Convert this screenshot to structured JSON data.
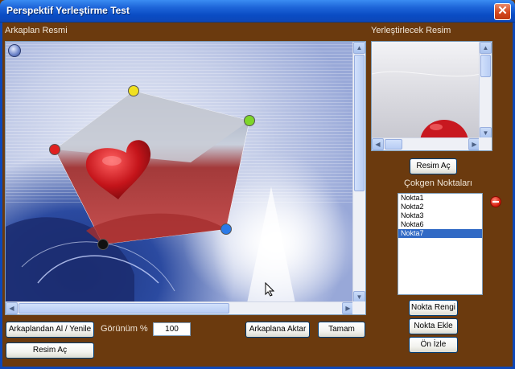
{
  "window": {
    "title": "Perspektif Yerleştirme Test",
    "close_glyph": "✕"
  },
  "labels": {
    "background_image": "Arkaplan Resmi",
    "image_to_place": "Yerleştirlecek Resim",
    "polygon_points": "Çokgen Noktaları",
    "view_percent": "Görünüm %"
  },
  "buttons": {
    "get_from_background": "Arkaplandan Al / Yenile",
    "open_image_left": "Resim Aç",
    "transfer_to_background": "Arkaplana Aktar",
    "ok": "Tamam",
    "open_image_right": "Resim Aç",
    "point_color": "Nokta Rengi",
    "add_point": "Nokta Ekle",
    "preview": "Ön İzle"
  },
  "zoom": {
    "value": "100"
  },
  "points_list": {
    "items": [
      "Nokta1",
      "Nokta2",
      "Nokta3",
      "Nokta6",
      "Nokta7"
    ],
    "selected_index": 4
  },
  "polygon_handles": [
    {
      "color": "#f0e020"
    },
    {
      "color": "#7ed62a"
    },
    {
      "color": "#2a7ae8"
    },
    {
      "color": "#111111"
    },
    {
      "color": "#e02020"
    }
  ]
}
